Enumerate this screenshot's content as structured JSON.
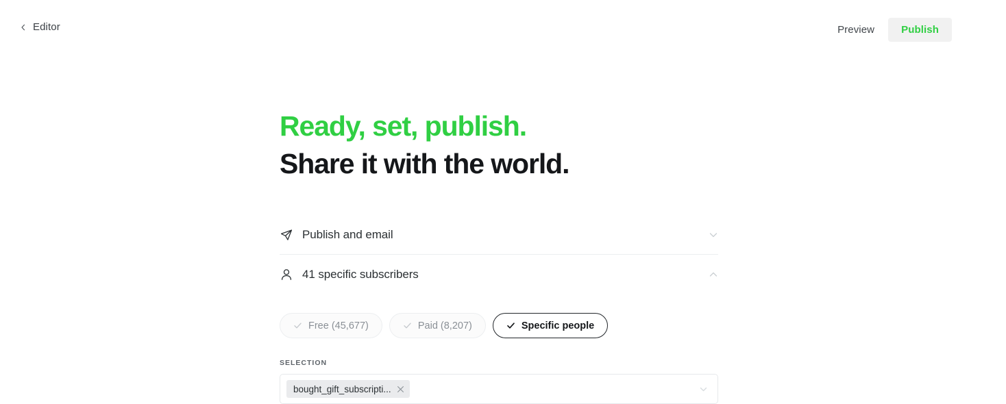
{
  "topbar": {
    "back_label": "Editor",
    "back_icon": "chevron-left-icon",
    "preview_label": "Preview",
    "publish_label": "Publish",
    "publish_color": "#30cf43",
    "publish_bg": "#f1f1f1"
  },
  "headline": {
    "line1": "Ready, set, publish.",
    "line2": "Share it with the world.",
    "line1_color": "#30cf43",
    "line2_color": "#15171a"
  },
  "rows": [
    {
      "icon": "send-icon",
      "label": "Publish and email",
      "chevron": "chevron-down-icon",
      "expanded": false
    },
    {
      "icon": "user-icon",
      "label": "41 specific subscribers",
      "chevron": "chevron-up-icon",
      "expanded": true
    }
  ],
  "pills": [
    {
      "label": "Free (45,677)",
      "icon": "check-icon",
      "active": false
    },
    {
      "label": "Paid (8,207)",
      "icon": "check-icon",
      "active": false
    },
    {
      "label": "Specific people",
      "icon": "check-icon",
      "active": true
    }
  ],
  "selection": {
    "label": "SELECTION",
    "tag": "bought_gift_subscripti...",
    "tag_remove_icon": "close-icon",
    "dropdown_icon": "chevron-down-icon"
  }
}
